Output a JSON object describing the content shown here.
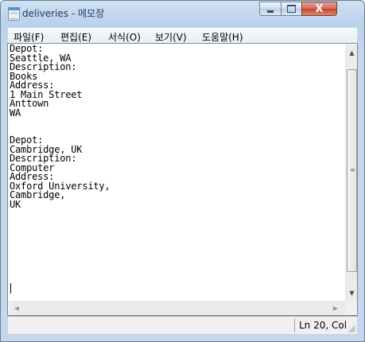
{
  "window": {
    "title": "deliveries - 메모장",
    "close_glyph": "X"
  },
  "menu": {
    "items": [
      "파일(F)",
      "편집(E)",
      "서식(O)",
      "보기(V)",
      "도움말(H)"
    ]
  },
  "editor": {
    "lines": [
      "Depot:",
      "Seattle, WA",
      "Description:",
      "Books",
      "Address:",
      "1 Main Street",
      "Anttown",
      "WA",
      "",
      "",
      "Depot:",
      "Cambridge, UK",
      "Description:",
      "Computer",
      "Address:",
      "Oxford University,",
      "Cambridge,",
      "UK",
      "",
      ""
    ]
  },
  "status": {
    "position": "Ln 20, Col"
  },
  "icons": {
    "app": "notepad-icon",
    "scroll_up": "▲",
    "scroll_down": "▼",
    "scroll_left": "◀",
    "scroll_right": "▶",
    "grip": "≡"
  }
}
